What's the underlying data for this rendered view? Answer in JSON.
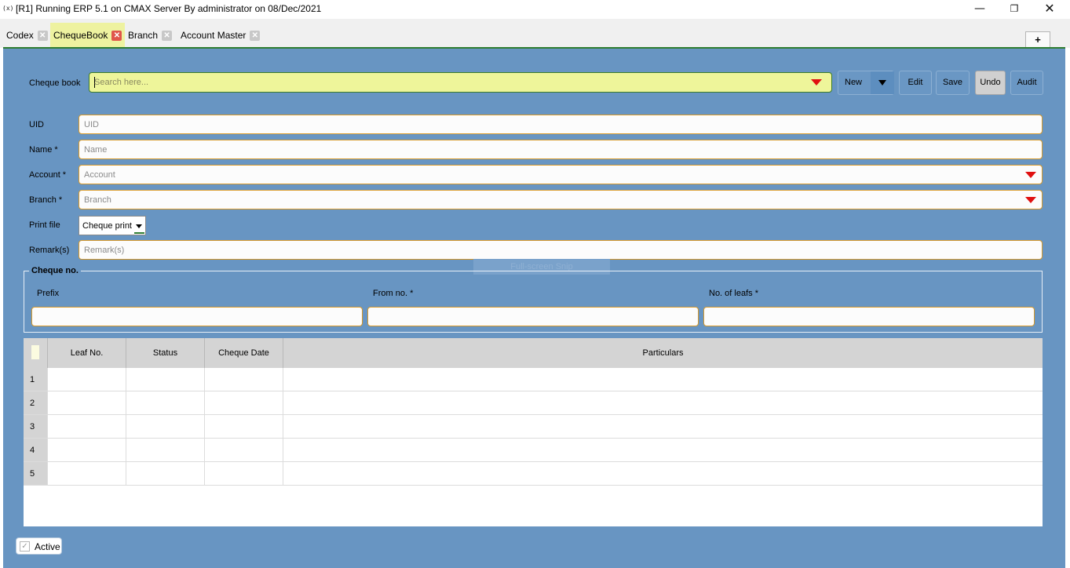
{
  "window": {
    "icon": "(x)",
    "title": "[R1] Running ERP 5.1 on CMAX Server By administrator on 08/Dec/2021",
    "min_glyph": "—",
    "max_glyph": "❐",
    "close_glyph": "✕"
  },
  "tabs": [
    {
      "label": "Codex",
      "active": false
    },
    {
      "label": "ChequeBook",
      "active": true
    },
    {
      "label": "Branch",
      "active": false
    },
    {
      "label": "Account Master",
      "active": false
    }
  ],
  "tab_close_glyph": "✕",
  "add_tab_label": "+",
  "toolbar": {
    "chequebook_label": "Cheque book",
    "search_placeholder": "Search here...",
    "new_label": "New",
    "edit_label": "Edit",
    "save_label": "Save",
    "undo_label": "Undo",
    "audit_label": "Audit"
  },
  "form": {
    "uid": {
      "label": "UID",
      "placeholder": "UID"
    },
    "name": {
      "label": "Name *",
      "placeholder": "Name"
    },
    "account": {
      "label": "Account *",
      "placeholder": "Account"
    },
    "branch": {
      "label": "Branch *",
      "placeholder": "Branch"
    },
    "print_file": {
      "label": "Print file",
      "value": "Cheque print"
    },
    "remarks": {
      "label": "Remark(s)",
      "placeholder": "Remark(s)"
    }
  },
  "overlay_text": "Full-screen Snip",
  "cheque_no": {
    "legend": "Cheque no.",
    "prefix_label": "Prefix",
    "from_label": "From no.  *",
    "leafs_label": "No. of leafs *"
  },
  "grid": {
    "columns": [
      "Leaf No.",
      "Status",
      "Cheque Date",
      "Particulars"
    ],
    "rows": [
      "1",
      "2",
      "3",
      "4",
      "5"
    ]
  },
  "active": {
    "label": "Active",
    "checked": true
  },
  "colors": {
    "panel": "#6895c2",
    "search_bg": "#eef59a",
    "active_tab": "#eef2a0",
    "field_border": "#d89a2a",
    "dropdown_arrow": "#e01010"
  }
}
